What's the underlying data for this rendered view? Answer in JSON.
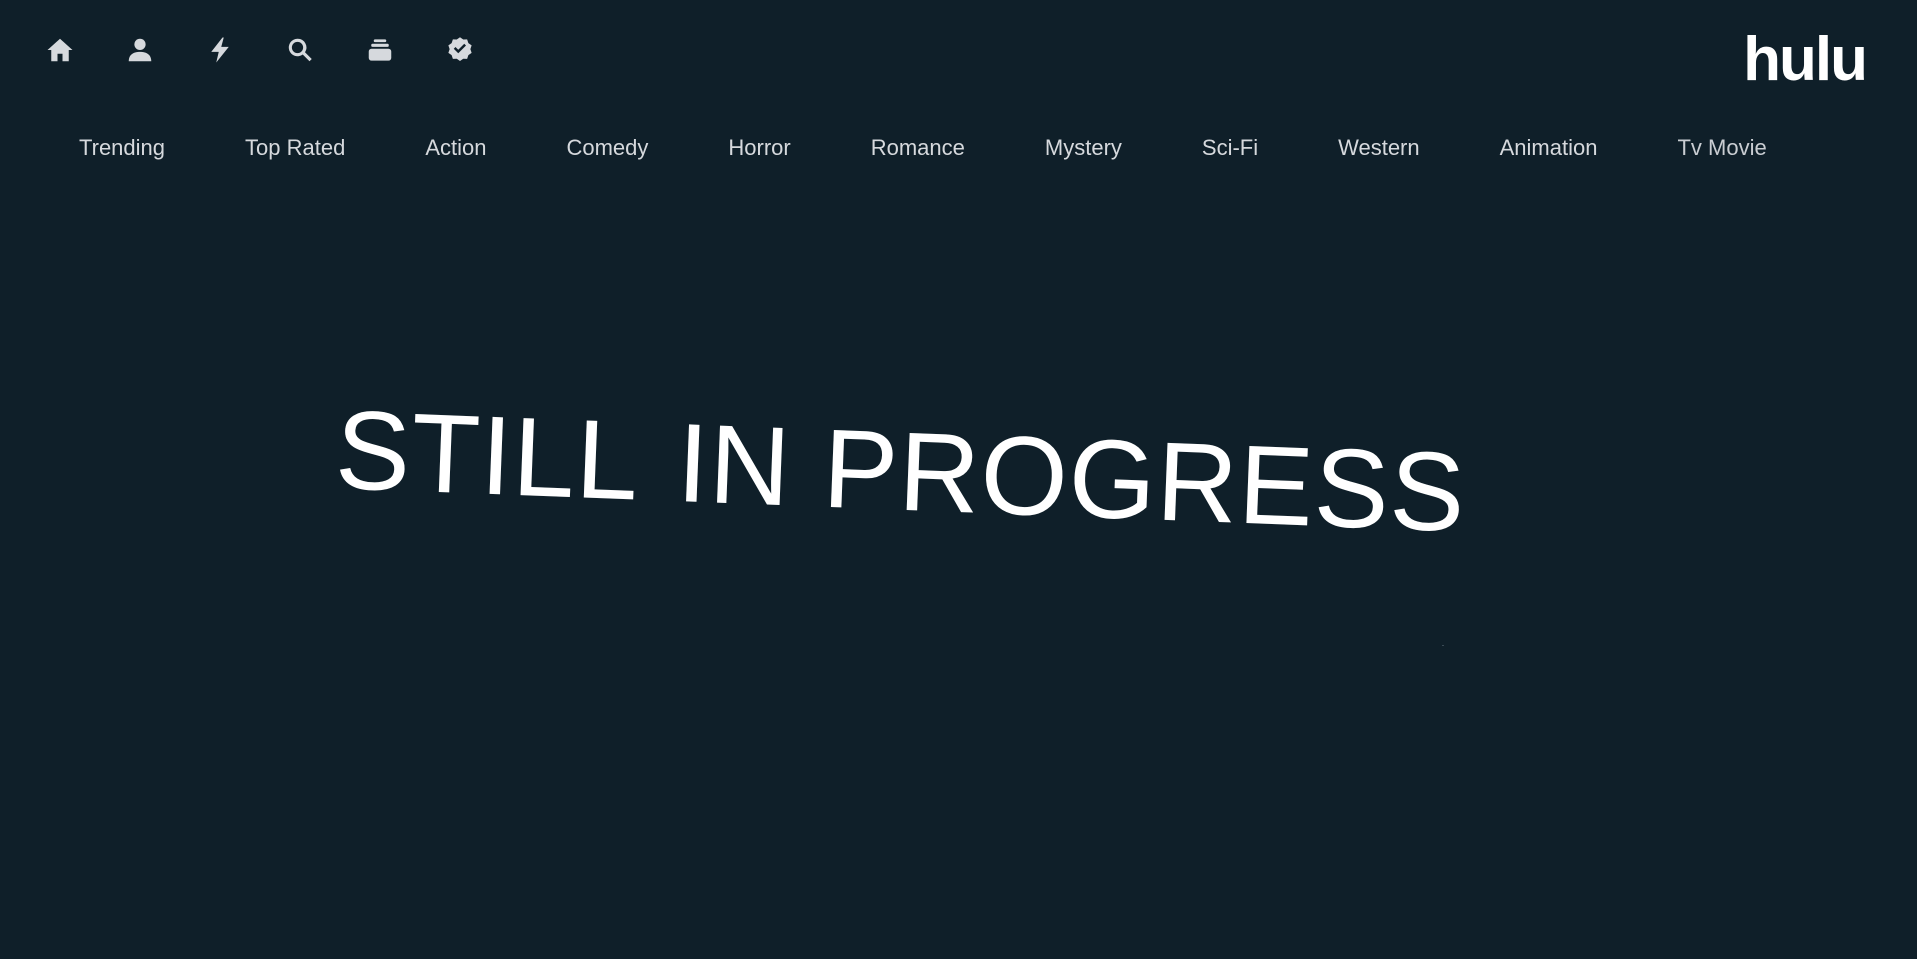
{
  "nav": {
    "icons": [
      {
        "name": "home-icon",
        "label": "Home"
      },
      {
        "name": "user-icon",
        "label": "Profile"
      },
      {
        "name": "bolt-icon",
        "label": "Trending"
      },
      {
        "name": "search-icon",
        "label": "Search"
      },
      {
        "name": "collection-icon",
        "label": "Collections"
      },
      {
        "name": "verified-icon",
        "label": "Verified"
      }
    ]
  },
  "logo": {
    "text": "hulu"
  },
  "genres": [
    "Trending",
    "Top Rated",
    "Action",
    "Comedy",
    "Horror",
    "Romance",
    "Mystery",
    "Sci-Fi",
    "Western",
    "Animation",
    "Tv Movie"
  ],
  "hero": {
    "word1": "STILL",
    "word2": "IN PROGRESS"
  },
  "colors": {
    "background": "#0f1f29",
    "text": "#d6d9dd",
    "accent": "#ffffff"
  }
}
